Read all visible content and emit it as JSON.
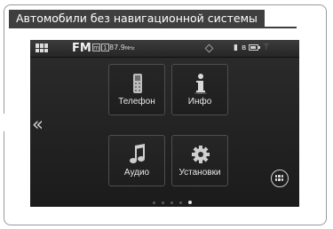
{
  "caption": "Автомобили без  навигационной системы",
  "statusbar": {
    "band": "FM",
    "box_icon_1": "m",
    "box_icon_2": "1",
    "frequency": "87.9",
    "frequency_unit": "MHz"
  },
  "tiles": [
    {
      "label": "Телефон",
      "icon": "phone-icon"
    },
    {
      "label": "Инфо",
      "icon": "info-icon"
    },
    {
      "label": "Аудио",
      "icon": "music-note-icon"
    },
    {
      "label": "Установки",
      "icon": "gear-icon"
    }
  ],
  "pager": {
    "pages": 5,
    "active_index": 4
  },
  "icons": {
    "menu": "grid-menu-icon",
    "back": "double-chevron-left-icon",
    "round_menu": "grid-round-icon",
    "status": [
      "bluetooth-icon",
      "phone-status-icon",
      "battery-icon",
      "signal-icon"
    ]
  },
  "colors": {
    "screen_bg": "#1e1e1e",
    "caption_bg": "#3f3f3f",
    "text": "#e8e8e8"
  }
}
